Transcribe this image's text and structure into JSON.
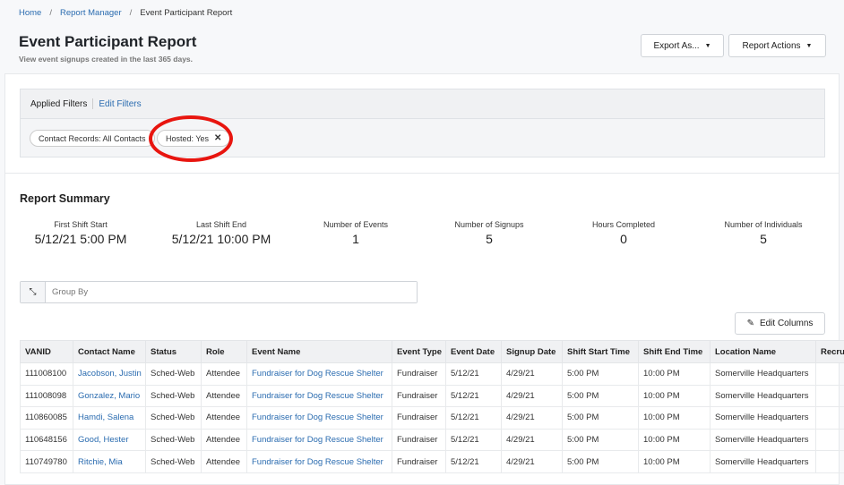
{
  "breadcrumb": {
    "home": "Home",
    "manager": "Report Manager",
    "current": "Event Participant Report"
  },
  "header": {
    "title": "Event Participant Report",
    "subtitle": "View event signups created in the last 365 days.",
    "export_label": "Export As...",
    "actions_label": "Report Actions"
  },
  "filters": {
    "label": "Applied Filters",
    "edit": "Edit Filters",
    "chips": [
      "Contact Records: All Contacts",
      "Hosted: Yes"
    ]
  },
  "summary": {
    "title": "Report Summary",
    "stats": [
      {
        "label": "First Shift Start",
        "value": "5/12/21 5:00 PM"
      },
      {
        "label": "Last Shift End",
        "value": "5/12/21 10:00 PM"
      },
      {
        "label": "Number of Events",
        "value": "1"
      },
      {
        "label": "Number of Signups",
        "value": "5"
      },
      {
        "label": "Hours Completed",
        "value": "0"
      },
      {
        "label": "Number of Individuals",
        "value": "5"
      }
    ]
  },
  "group_by": {
    "placeholder": "Group By"
  },
  "edit_columns": "Edit Columns",
  "table": {
    "columns": [
      "VANID",
      "Contact Name",
      "Status",
      "Role",
      "Event Name",
      "Event Type",
      "Event Date",
      "Signup Date",
      "Shift Start Time",
      "Shift End Time",
      "Location Name",
      "Recru"
    ],
    "rows": [
      [
        "111008100",
        "Jacobson, Justin",
        "Sched-Web",
        "Attendee",
        "Fundraiser for Dog Rescue Shelter",
        "Fundraiser",
        "5/12/21",
        "4/29/21",
        "5:00 PM",
        "10:00 PM",
        "Somerville Headquarters",
        ""
      ],
      [
        "111008098",
        "Gonzalez, Mario",
        "Sched-Web",
        "Attendee",
        "Fundraiser for Dog Rescue Shelter",
        "Fundraiser",
        "5/12/21",
        "4/29/21",
        "5:00 PM",
        "10:00 PM",
        "Somerville Headquarters",
        ""
      ],
      [
        "110860085",
        "Hamdi, Salena",
        "Sched-Web",
        "Attendee",
        "Fundraiser for Dog Rescue Shelter",
        "Fundraiser",
        "5/12/21",
        "4/29/21",
        "5:00 PM",
        "10:00 PM",
        "Somerville Headquarters",
        ""
      ],
      [
        "110648156",
        "Good, Hester",
        "Sched-Web",
        "Attendee",
        "Fundraiser for Dog Rescue Shelter",
        "Fundraiser",
        "5/12/21",
        "4/29/21",
        "5:00 PM",
        "10:00 PM",
        "Somerville Headquarters",
        ""
      ],
      [
        "110749780",
        "Ritchie, Mia",
        "Sched-Web",
        "Attendee",
        "Fundraiser for Dog Rescue Shelter",
        "Fundraiser",
        "5/12/21",
        "4/29/21",
        "5:00 PM",
        "10:00 PM",
        "Somerville Headquarters",
        ""
      ]
    ]
  }
}
